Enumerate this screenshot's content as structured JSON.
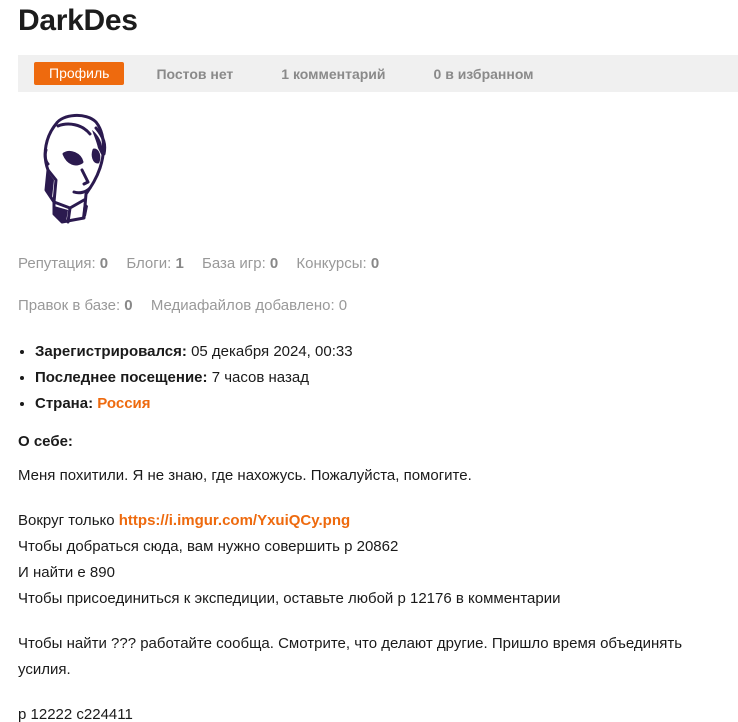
{
  "profile": {
    "username": "DarkDes"
  },
  "tabs": [
    {
      "label": "Профиль"
    },
    {
      "label": "Постов нет"
    },
    {
      "label": "1 комментарий"
    },
    {
      "label": "0 в избранном"
    }
  ],
  "stats": {
    "reputation_label": "Репутация:",
    "reputation_value": "0",
    "blogs_label": "Блоги:",
    "blogs_value": "1",
    "gamebase_label": "База игр:",
    "gamebase_value": "0",
    "contests_label": "Конкурсы:",
    "contests_value": "0",
    "edits_label": "Правок в базе:",
    "edits_value": "0",
    "media_label": "Медиафайлов добавлено:",
    "media_value": "0"
  },
  "info": {
    "registered_label": "Зарегистрировался:",
    "registered_value": "05 декабря 2024, 00:33",
    "last_visit_label": "Последнее посещение:",
    "last_visit_value": "7 часов назад",
    "country_label": "Страна:",
    "country_value": "Россия"
  },
  "about": {
    "title": "О себе:",
    "p1": "Меня похитили. Я не знаю, где нахожусь. Пожалуйста, помогите.",
    "p2_prefix": "Вокруг только ",
    "p2_link": "https://i.imgur.com/YxuiQCy.png",
    "p2_line2": "Чтобы добраться сюда, вам нужно совершить p 20862",
    "p2_line3": "И найти e 890",
    "p2_line4": "Чтобы присоединиться к экспедиции, оставьте любой p 12176 в комментарии",
    "p3": "Чтобы найти ??? работайте сообща. Смотрите, что делают другие. Пришло время объединять усилия.",
    "p4": "p 12222 c224411"
  },
  "colors": {
    "accent": "#ee6a0e",
    "tabs_bg": "#f0f0f0",
    "avatar_ink": "#2b1a4f"
  }
}
